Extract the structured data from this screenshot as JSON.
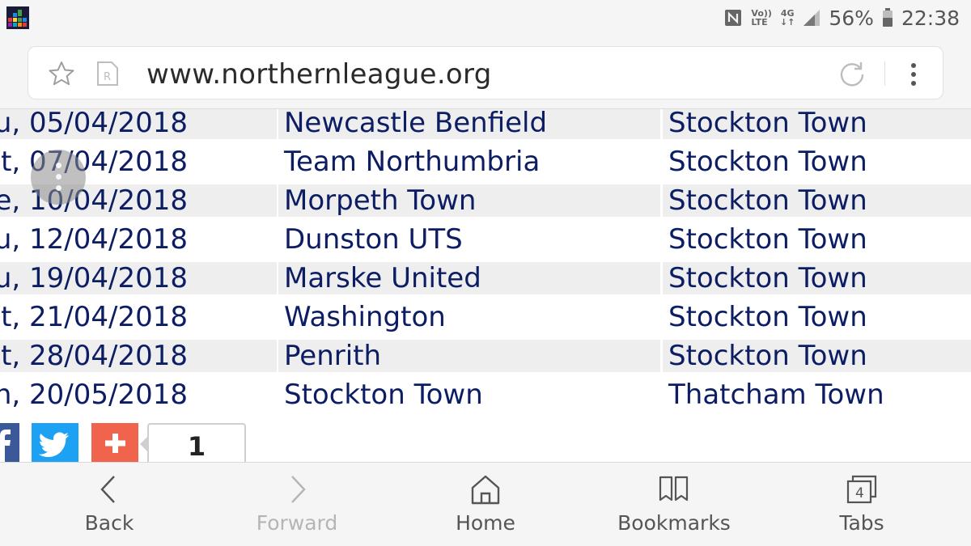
{
  "status_bar": {
    "volte_top": "Vo))",
    "volte_bottom": "LTE",
    "network_type": "4G",
    "network_arrows": "↓↑",
    "battery_percent": "56%",
    "time": "22:38"
  },
  "browser": {
    "url": "www.northernleague.org",
    "reader_icon_letter": "R"
  },
  "fixtures": [
    {
      "date": "u, 05/04/2018",
      "home": "Newcastle Benfield",
      "away": "Stockton Town"
    },
    {
      "date": "t, 07/04/2018",
      "home": "Team Northumbria",
      "away": "Stockton Town"
    },
    {
      "date": "e, 10/04/2018",
      "home": "Morpeth Town",
      "away": "Stockton Town"
    },
    {
      "date": "u, 12/04/2018",
      "home": "Dunston UTS",
      "away": "Stockton Town"
    },
    {
      "date": "u, 19/04/2018",
      "home": "Marske United",
      "away": "Stockton Town"
    },
    {
      "date": "t, 21/04/2018",
      "home": "Washington",
      "away": "Stockton Town"
    },
    {
      "date": "t, 28/04/2018",
      "home": "Penrith",
      "away": "Stockton Town"
    },
    {
      "date": "n, 20/05/2018",
      "home": "Stockton Town",
      "away": "Thatcham Town"
    }
  ],
  "share": {
    "count": "1"
  },
  "toolbar": {
    "back_label": "Back",
    "forward_label": "Forward",
    "home_label": "Home",
    "bookmarks_label": "Bookmarks",
    "tabs_label": "Tabs",
    "tabs_count": "4"
  },
  "colors": {
    "link_text": "#0d1d63",
    "row_shade": "#eeeeee",
    "facebook": "#3b5998",
    "twitter": "#1da1f2",
    "share_plus": "#f0634c"
  }
}
